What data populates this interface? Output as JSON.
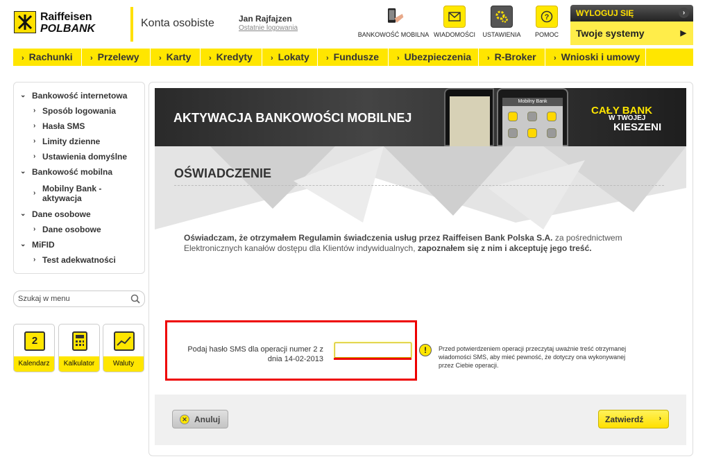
{
  "header": {
    "logo_line1": "Raiffeisen",
    "logo_line2": "POLBANK",
    "section_title": "Konta osobiste",
    "user_name": "Jan Rajfajzen",
    "last_login_link": "Ostatnie logowania",
    "icons": [
      {
        "label": "BANKOWOŚĆ MOBILNA",
        "icon": "mobile-banking-icon"
      },
      {
        "label": "WIADOMOŚCI",
        "icon": "envelope-icon"
      },
      {
        "label": "USTAWIENIA",
        "icon": "gears-icon"
      },
      {
        "label": "POMOC",
        "icon": "question-icon"
      }
    ],
    "logout_label": "WYLOGUJ SIĘ",
    "systems_label": "Twoje systemy"
  },
  "nav": [
    "Rachunki",
    "Przelewy",
    "Karty",
    "Kredyty",
    "Lokaty",
    "Fundusze",
    "Ubezpieczenia",
    "R-Broker",
    "Wnioski i umowy"
  ],
  "sidebar": {
    "internet": "Bankowość internetowa",
    "login_method": "Sposób logowania",
    "sms_passwords": "Hasła SMS",
    "daily_limits": "Limity dzienne",
    "default_settings": "Ustawienia domyślne",
    "mobile": "Bankowość mobilna",
    "mobile_activation": "Mobilny Bank -",
    "mobile_activation_2": "aktywacja",
    "personal": "Dane osobowe",
    "personal_data": "Dane osobowe",
    "mifid": "MiFID",
    "adequacy": "Test adekwatności"
  },
  "search": {
    "label": "Szukaj w menu"
  },
  "tiles": {
    "calendar": "Kalendarz",
    "calendar_day": "2",
    "calculator": "Kalkulator",
    "currencies": "Waluty"
  },
  "banner": {
    "title": "AKTYWACJA BANKOWOŚCI MOBILNEJ",
    "slogan1": "CAŁY BANK",
    "slogan2": "W TWOJEJ",
    "slogan3": "KIESZENI",
    "phone_app_title": "Mobilny Bank"
  },
  "content": {
    "heading": "OŚWIADCZENIE",
    "statement_bold1": "Oświadczam, że otrzymałem Regulamin świadczenia usług przez Raiffeisen Bank Polska S.A.",
    "statement_text1": " za pośrednictwem Elektronicznych kanałów dostępu dla Klientów indywidualnych, ",
    "statement_bold2": "zapoznałem się z nim i akceptuję jego treść."
  },
  "sms": {
    "label": "Podaj hasło SMS dla operacji numer 2 z dnia 14-02-2013",
    "value": "",
    "hint": "Przed potwierdzeniem operacji przeczytaj uważnie treść otrzymanej wiadomości SMS, aby mieć pewność, że dotyczy ona wykonywanej przez Ciebie operacji."
  },
  "actions": {
    "cancel": "Anuluj",
    "confirm": "Zatwierdź"
  },
  "colors": {
    "brand_yellow": "#ffe600",
    "alert_red": "#ee0000"
  }
}
